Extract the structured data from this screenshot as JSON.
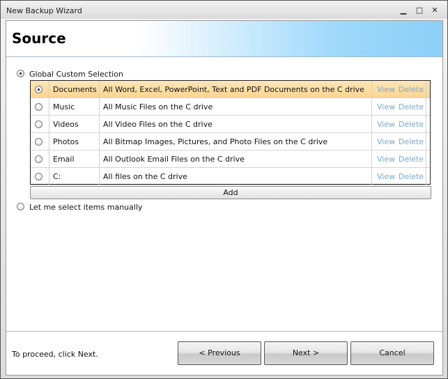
{
  "window": {
    "title": "New Backup Wizard",
    "minimize_glyph": "▁",
    "maximize_glyph": "□",
    "close_glyph": "✕"
  },
  "header": {
    "title": "Source"
  },
  "options": {
    "global_label": "Global Custom Selection",
    "manual_label": "Let me select items manually",
    "selected": "global"
  },
  "items": [
    {
      "name": "Documents",
      "description": "All Word, Excel, PowerPoint, Text and PDF Documents on the C drive",
      "view": "View",
      "delete": "Delete",
      "selected": true
    },
    {
      "name": "Music",
      "description": "All Music Files on the C drive",
      "view": "View",
      "delete": "Delete",
      "selected": false
    },
    {
      "name": "Videos",
      "description": "All Video Files on the C drive",
      "view": "View",
      "delete": "Delete",
      "selected": false
    },
    {
      "name": "Photos",
      "description": "All Bitmap Images, Pictures, and Photo Files on the C drive",
      "view": "View",
      "delete": "Delete",
      "selected": false
    },
    {
      "name": "Email",
      "description": "All Outlook Email Files on the C drive",
      "view": "View",
      "delete": "Delete",
      "selected": false
    },
    {
      "name": "C:",
      "description": "All files on the C drive",
      "view": "View",
      "delete": "Delete",
      "selected": false
    }
  ],
  "add_label": "Add",
  "footer": {
    "hint": "To proceed, click Next.",
    "previous_label": "< Previous",
    "next_label": "Next >",
    "cancel_label": "Cancel"
  },
  "colors": {
    "link": "#79a9cc",
    "selected_row": "#fbd592",
    "header_accent": "#8dcff8"
  }
}
